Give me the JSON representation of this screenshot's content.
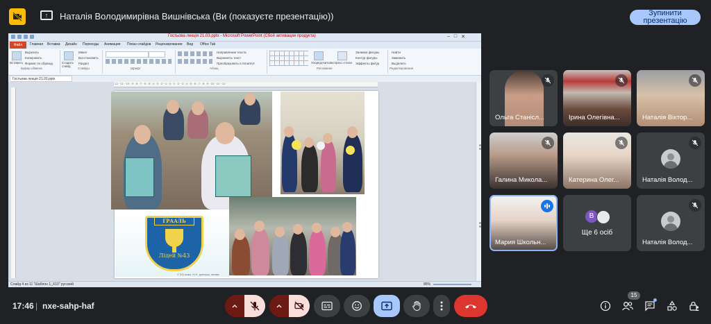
{
  "top_bar": {
    "presenter_title": "Наталія Володимирівна Вишнівська (Ви (показуєте презентацію))",
    "stop_presenting_label": "Зупинити презентацію"
  },
  "ppt": {
    "window_title": "Гостьова лекція 21.03.pptx  -  Microsoft PowerPoint (Сбой активации продукта)",
    "file_tab": "Файл",
    "tabs": [
      "Главная",
      "Вставка",
      "Дизайн",
      "Переходы",
      "Анимация",
      "Показ слайдов",
      "Рецензирование",
      "Вид",
      "Office Tab"
    ],
    "ribbon": {
      "paste": "Вставить",
      "cut": "Вырезать",
      "copy": "Копировать",
      "format_painter": "Формат по образцу",
      "clipboard_group": "Буфер обмена",
      "new_slide": "Создать слайд",
      "layout": "Макет",
      "reset": "Восстановить",
      "section": "Раздел",
      "slides_group": "Слайды",
      "font_group": "Шрифт",
      "text_direction": "Направление текста",
      "align_text": "Выровнять текст",
      "smartart": "Преобразовать в SmartArt",
      "paragraph_group": "Абзац",
      "arrange": "Упорядочить",
      "quick_styles": "Экспресс-стили",
      "shape_fill": "Заливка фигуры",
      "shape_outline": "Контур фигуры",
      "shape_effects": "Эффекты фигур",
      "drawing_group": "Рисование",
      "find": "Найти",
      "replace": "Заменить",
      "select": "Выделить",
      "editing_group": "Редактирование"
    },
    "doc_tab": "Гостьова лекція 21.03.pptx",
    "ruler": "·12· ·11· ·10· ·9· ·8· ·7· ·6· ·5· ·4· ·3· ·2· ·1· ·0· ·1· ·2· ·3· ·4· ·5· ·6· ·7· ·8· ·9· ·10· ·11· ·12·",
    "status_left": "Слайд 4 из 11   \"Шаблон 1_Х10\"   русский",
    "zoom": "86%",
    "slide": {
      "emblem_banner": "ГРААЛЬ",
      "emblem_school": "Ліцей №43",
      "bottom_text": "У 3-Б класі, Н.Н. донська, лісова"
    }
  },
  "participants": [
    {
      "name": "Ольга Станісл...",
      "muted": true
    },
    {
      "name": "Ірина Олегівна...",
      "muted": true
    },
    {
      "name": "Наталія Віктор...",
      "muted": true
    },
    {
      "name": "Галина Микола...",
      "muted": true
    },
    {
      "name": "Катерина Олег...",
      "muted": true
    },
    {
      "name": "Наталія Волод...",
      "muted": true
    },
    {
      "name": "Мария Школьн...",
      "speaking": true
    },
    {
      "more": "Ще 6 осіб",
      "avatar_letter": "В"
    },
    {
      "name": "Наталія Волод...",
      "muted": true
    }
  ],
  "bottom_bar": {
    "time": "17:46",
    "separator": "|",
    "meeting_code": "nxe-sahp-haf",
    "participants_count": "15"
  },
  "colors": {
    "background": "#202124",
    "tile": "#3c4043",
    "stop_button": "#a8c7fa",
    "end_call": "#dc362e",
    "muted_red": "#f9dedc",
    "accent_blue": "#1a73e8"
  }
}
